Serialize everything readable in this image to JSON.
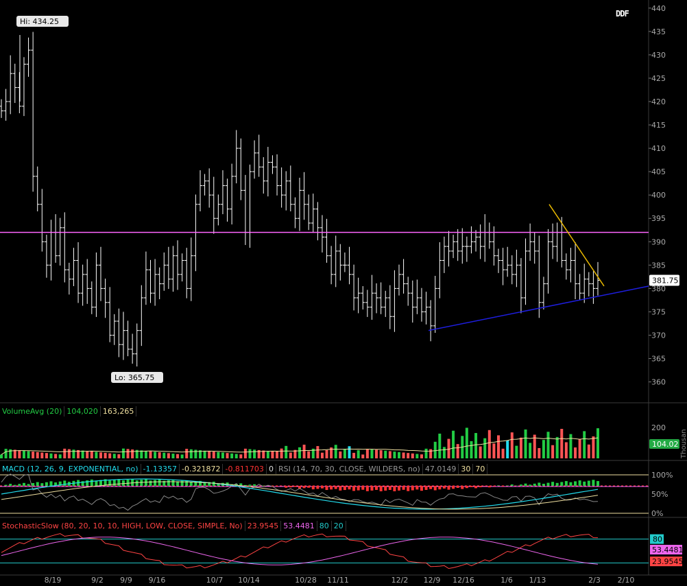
{
  "watermark": "DDF",
  "price_labels": {
    "hi": "Hi: 434.25",
    "lo": "Lo: 365.75",
    "last": "381.75"
  },
  "volume_panel": {
    "study": "VolumeAvg (20)",
    "value1": "104,020",
    "value2": "163,265",
    "last_badge": "104.02",
    "axis_unit": "Thousan"
  },
  "macd_panel": {
    "study": "MACD (12, 26, 9, EXPONENTIAL, no)",
    "v1": "-1.13357",
    "v2": "-0.321872",
    "v3": "-0.811703",
    "v4": "0"
  },
  "rsi_panel": {
    "study": "RSI (14, 70, 30, CLOSE, WILDERS, no)",
    "value": "47.0149",
    "ob": "30",
    "os": "70"
  },
  "stoch_panel": {
    "study": "StochasticSlow (80, 20, 10, 10, HIGH, LOW, CLOSE, SIMPLE, No)",
    "k": "23.9545",
    "d": "53.4481",
    "ob": "80",
    "os": "20",
    "badge_ob": "80",
    "badge_d": "53.4481",
    "badge_k": "23.9545"
  },
  "colors": {
    "background": "#000000",
    "bar": "#ffffff",
    "resistance": "#ff66ff",
    "trend_down": "#e8b800",
    "trend_up": "#1e1ee0",
    "vol_up": "#22cc44",
    "vol_down": "#ff5555",
    "vol_cyan": "#22ddee",
    "avg_line": "#f0e0a0",
    "macd_line": "#22ddee",
    "macd_signal": "#f0e0a0",
    "rsi_line": "#888888",
    "stoch_k": "#ff4444",
    "stoch_d": "#ee66ee",
    "level_cyan": "#22cccc"
  },
  "chart_data": {
    "type": "ohlc",
    "price_axis": {
      "ticks": [
        360,
        365,
        370,
        375,
        380,
        385,
        390,
        395,
        400,
        405,
        410,
        415,
        420,
        425,
        430,
        435,
        440
      ],
      "ylim": [
        357,
        441
      ]
    },
    "x_tick_labels": [
      "8/19",
      "9/2",
      "9/9",
      "9/16",
      "10/7",
      "10/14",
      "10/28",
      "11/11",
      "12/2",
      "12/9",
      "12/16",
      "1/6",
      "1/13",
      "2/3",
      "2/10"
    ],
    "high_label": 434.25,
    "low_label": 365.75,
    "last_price": 381.75,
    "horizontal_line": 392,
    "trendline_down": {
      "from": 398,
      "to": 380.5
    },
    "trendline_up": {
      "from": 371,
      "to": 380.5
    },
    "closes": [
      418,
      420,
      426,
      423,
      419,
      428,
      431,
      404,
      398,
      390,
      385,
      392,
      387,
      393,
      384,
      382,
      386,
      379,
      383,
      380,
      376,
      385,
      380,
      377,
      370,
      373,
      368,
      371,
      367,
      366,
      371,
      378,
      384,
      379,
      383,
      381,
      385,
      382,
      387,
      383,
      386,
      380,
      387,
      398,
      402,
      403,
      400,
      395,
      398,
      402,
      397,
      404,
      410,
      401,
      392,
      405,
      409,
      406,
      403,
      407,
      406,
      402,
      400,
      403,
      398,
      395,
      401,
      398,
      394,
      397,
      393,
      391,
      387,
      383,
      388,
      385,
      385,
      383,
      378,
      379,
      377,
      376,
      379,
      378,
      376,
      378,
      374,
      380,
      383,
      381,
      379,
      376,
      378,
      375,
      376,
      372,
      380,
      386,
      389,
      388,
      390,
      388,
      389,
      389,
      390,
      391,
      389,
      392,
      390,
      387,
      386,
      384,
      385,
      383,
      385,
      378,
      388,
      390,
      388,
      377,
      381,
      390,
      389,
      392,
      386,
      384,
      386,
      381,
      379,
      382,
      381,
      380,
      381.75
    ],
    "volume_axis": {
      "ticks": [
        200
      ],
      "ylim": [
        0,
        250
      ]
    },
    "volume_last": 104.02,
    "rsi_axis": {
      "ticks": [
        "100%",
        "50%",
        "0%"
      ]
    },
    "stoch_axis": {
      "ticks": [
        "80",
        "20"
      ]
    },
    "rsi_value": 47.0149,
    "stoch_k_value": 23.9545,
    "stoch_d_value": 53.4481
  }
}
